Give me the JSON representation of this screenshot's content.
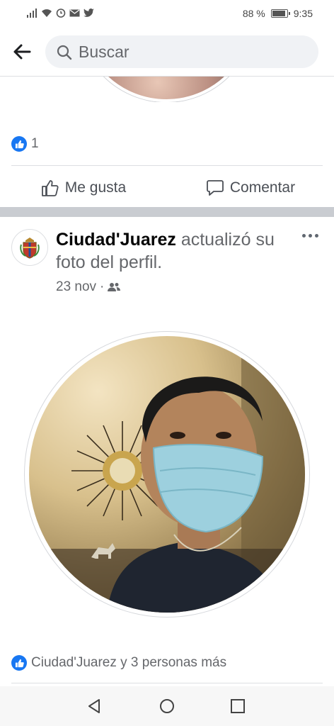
{
  "status_bar": {
    "battery": "88 %",
    "battery_level": 0.88,
    "time": "9:35"
  },
  "header": {
    "search_placeholder": "Buscar"
  },
  "previous_post": {
    "like_count": "1",
    "like_label": "Me gusta",
    "comment_label": "Comentar"
  },
  "post": {
    "author": "Ciudad'Juarez",
    "action_text": "actualizó su foto del perfil.",
    "date": "23 nov",
    "separator": "·",
    "audience_icon": "friends-icon",
    "likes_summary": "Ciudad'Juarez y 3 personas más"
  },
  "colors": {
    "brand_blue": "#1877f2",
    "separator_gray": "#c9ccd1",
    "muted_text": "#65676b"
  },
  "icons": [
    "signal-icon",
    "wifi-icon",
    "alarm-icon",
    "mail-icon",
    "twitter-icon",
    "battery-icon",
    "back-arrow-icon",
    "search-icon",
    "like-icon",
    "comment-icon",
    "more-options-icon",
    "back-nav-icon",
    "home-nav-icon",
    "recents-nav-icon"
  ]
}
